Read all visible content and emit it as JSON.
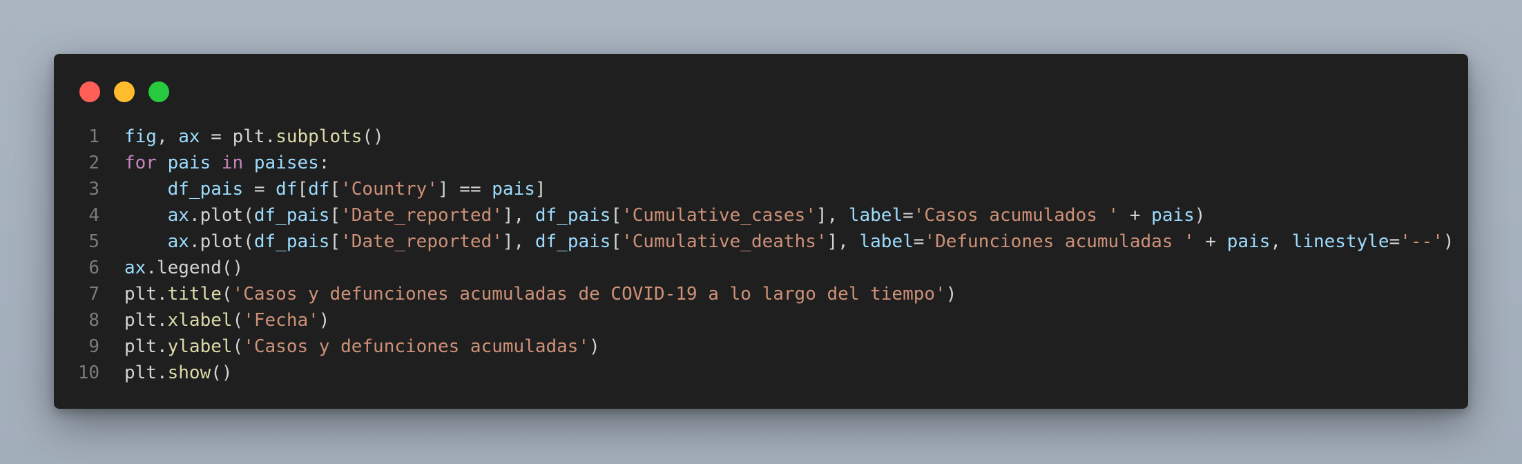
{
  "colors": {
    "background": "#a8b3bf",
    "editor_bg": "#1f1f1f",
    "close": "#ff5f56",
    "minimize": "#ffbd2e",
    "maximize": "#27c93f",
    "line_number": "#7b7b7b",
    "variable": "#9cdcfe",
    "function": "#dcdcaa",
    "keyword": "#c586c0",
    "string": "#ce9178",
    "punctuation": "#d4d4d4"
  },
  "window_controls": [
    {
      "name": "close-icon",
      "color": "#ff5f56"
    },
    {
      "name": "minimize-icon",
      "color": "#ffbd2e"
    },
    {
      "name": "maximize-icon",
      "color": "#27c93f"
    }
  ],
  "code": {
    "lines": [
      {
        "number": "1",
        "tokens": [
          {
            "t": "fig",
            "c": "v"
          },
          {
            "t": ", ",
            "c": "p"
          },
          {
            "t": "ax",
            "c": "v"
          },
          {
            "t": " = ",
            "c": "p"
          },
          {
            "t": "plt",
            "c": "p"
          },
          {
            "t": ".",
            "c": "p"
          },
          {
            "t": "subplots",
            "c": "f"
          },
          {
            "t": "()",
            "c": "p"
          }
        ]
      },
      {
        "number": "2",
        "tokens": [
          {
            "t": "for",
            "c": "k"
          },
          {
            "t": " ",
            "c": "p"
          },
          {
            "t": "pais",
            "c": "v"
          },
          {
            "t": " ",
            "c": "p"
          },
          {
            "t": "in",
            "c": "k"
          },
          {
            "t": " ",
            "c": "p"
          },
          {
            "t": "paises",
            "c": "v"
          },
          {
            "t": ":",
            "c": "p"
          }
        ]
      },
      {
        "number": "3",
        "tokens": [
          {
            "t": "    ",
            "c": "p"
          },
          {
            "t": "df_pais",
            "c": "v"
          },
          {
            "t": " = ",
            "c": "p"
          },
          {
            "t": "df",
            "c": "v"
          },
          {
            "t": "[",
            "c": "p"
          },
          {
            "t": "df",
            "c": "v"
          },
          {
            "t": "[",
            "c": "p"
          },
          {
            "t": "'Country'",
            "c": "s"
          },
          {
            "t": "] == ",
            "c": "p"
          },
          {
            "t": "pais",
            "c": "v"
          },
          {
            "t": "]",
            "c": "p"
          }
        ]
      },
      {
        "number": "4",
        "tokens": [
          {
            "t": "    ",
            "c": "p"
          },
          {
            "t": "ax",
            "c": "v"
          },
          {
            "t": ".plot(",
            "c": "p"
          },
          {
            "t": "df_pais",
            "c": "v"
          },
          {
            "t": "[",
            "c": "p"
          },
          {
            "t": "'Date_reported'",
            "c": "s"
          },
          {
            "t": "], ",
            "c": "p"
          },
          {
            "t": "df_pais",
            "c": "v"
          },
          {
            "t": "[",
            "c": "p"
          },
          {
            "t": "'Cumulative_cases'",
            "c": "s"
          },
          {
            "t": "], ",
            "c": "p"
          },
          {
            "t": "label",
            "c": "v"
          },
          {
            "t": "=",
            "c": "p"
          },
          {
            "t": "'Casos acumulados '",
            "c": "s"
          },
          {
            "t": " + ",
            "c": "p"
          },
          {
            "t": "pais",
            "c": "v"
          },
          {
            "t": ")",
            "c": "p"
          }
        ]
      },
      {
        "number": "5",
        "tokens": [
          {
            "t": "    ",
            "c": "p"
          },
          {
            "t": "ax",
            "c": "v"
          },
          {
            "t": ".plot(",
            "c": "p"
          },
          {
            "t": "df_pais",
            "c": "v"
          },
          {
            "t": "[",
            "c": "p"
          },
          {
            "t": "'Date_reported'",
            "c": "s"
          },
          {
            "t": "], ",
            "c": "p"
          },
          {
            "t": "df_pais",
            "c": "v"
          },
          {
            "t": "[",
            "c": "p"
          },
          {
            "t": "'Cumulative_deaths'",
            "c": "s"
          },
          {
            "t": "], ",
            "c": "p"
          },
          {
            "t": "label",
            "c": "v"
          },
          {
            "t": "=",
            "c": "p"
          },
          {
            "t": "'Defunciones acumuladas '",
            "c": "s"
          },
          {
            "t": " + ",
            "c": "p"
          },
          {
            "t": "pais",
            "c": "v"
          },
          {
            "t": ", ",
            "c": "p"
          },
          {
            "t": "linestyle",
            "c": "v"
          },
          {
            "t": "=",
            "c": "p"
          },
          {
            "t": "'--'",
            "c": "s"
          },
          {
            "t": ")",
            "c": "p"
          }
        ]
      },
      {
        "number": "6",
        "tokens": [
          {
            "t": "ax",
            "c": "v"
          },
          {
            "t": ".legend()",
            "c": "p"
          }
        ]
      },
      {
        "number": "7",
        "tokens": [
          {
            "t": "plt",
            "c": "p"
          },
          {
            "t": ".",
            "c": "p"
          },
          {
            "t": "title",
            "c": "f"
          },
          {
            "t": "(",
            "c": "p"
          },
          {
            "t": "'Casos y defunciones acumuladas de COVID-19 a lo largo del tiempo'",
            "c": "s"
          },
          {
            "t": ")",
            "c": "p"
          }
        ]
      },
      {
        "number": "8",
        "tokens": [
          {
            "t": "plt",
            "c": "p"
          },
          {
            "t": ".",
            "c": "p"
          },
          {
            "t": "xlabel",
            "c": "f"
          },
          {
            "t": "(",
            "c": "p"
          },
          {
            "t": "'Fecha'",
            "c": "s"
          },
          {
            "t": ")",
            "c": "p"
          }
        ]
      },
      {
        "number": "9",
        "tokens": [
          {
            "t": "plt",
            "c": "p"
          },
          {
            "t": ".",
            "c": "p"
          },
          {
            "t": "ylabel",
            "c": "f"
          },
          {
            "t": "(",
            "c": "p"
          },
          {
            "t": "'Casos y defunciones acumuladas'",
            "c": "s"
          },
          {
            "t": ")",
            "c": "p"
          }
        ]
      },
      {
        "number": "10",
        "tokens": [
          {
            "t": "plt",
            "c": "p"
          },
          {
            "t": ".",
            "c": "p"
          },
          {
            "t": "show",
            "c": "f"
          },
          {
            "t": "()",
            "c": "p"
          }
        ]
      }
    ]
  }
}
